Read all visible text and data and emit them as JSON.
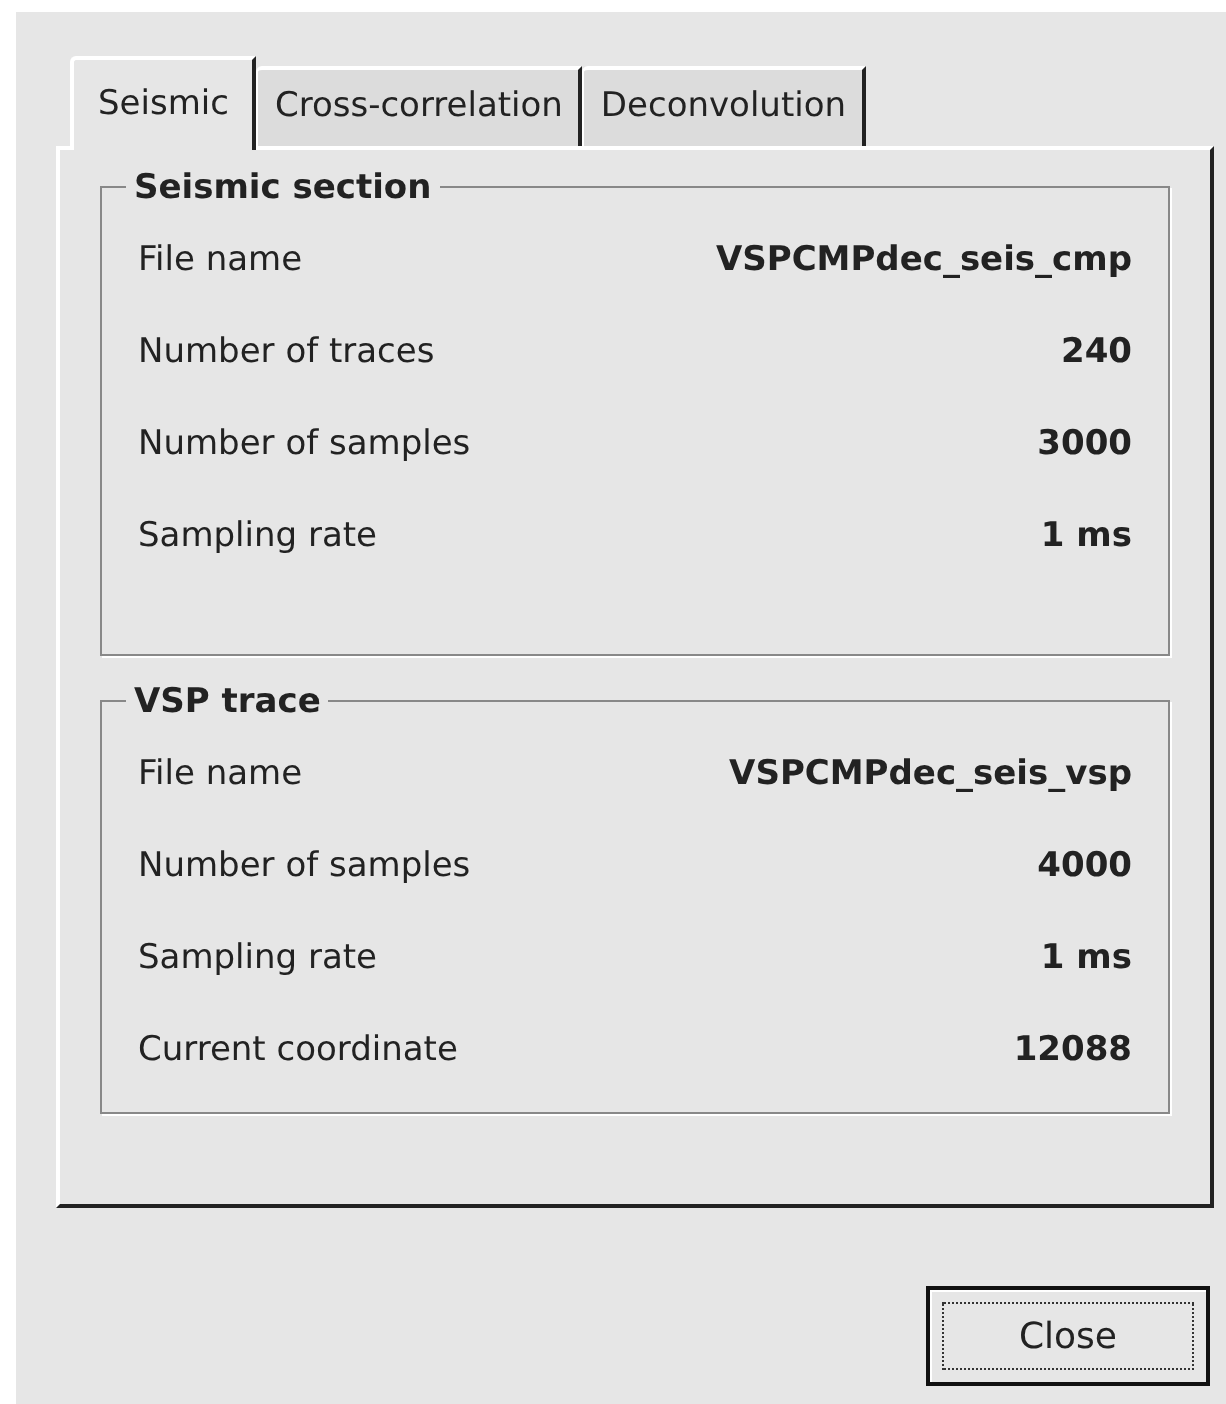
{
  "tabs": [
    {
      "label": "Seismic",
      "selected": true
    },
    {
      "label": "Cross-correlation",
      "selected": false
    },
    {
      "label": "Deconvolution",
      "selected": false
    }
  ],
  "groups": [
    {
      "title": "Seismic section",
      "rows": [
        {
          "label": "File name",
          "value": "VSPCMPdec_seis_cmp"
        },
        {
          "label": "Number of traces",
          "value": "240"
        },
        {
          "label": "Number of samples",
          "value": "3000"
        },
        {
          "label": "Sampling rate",
          "value": "1 ms"
        }
      ]
    },
    {
      "title": "VSP trace",
      "rows": [
        {
          "label": "File name",
          "value": "VSPCMPdec_seis_vsp"
        },
        {
          "label": "Number of samples",
          "value": "4000"
        },
        {
          "label": "Sampling rate",
          "value": "1 ms"
        },
        {
          "label": "Current coordinate",
          "value": "12088"
        }
      ]
    }
  ],
  "close_button": {
    "label": "Close",
    "focused": true
  }
}
